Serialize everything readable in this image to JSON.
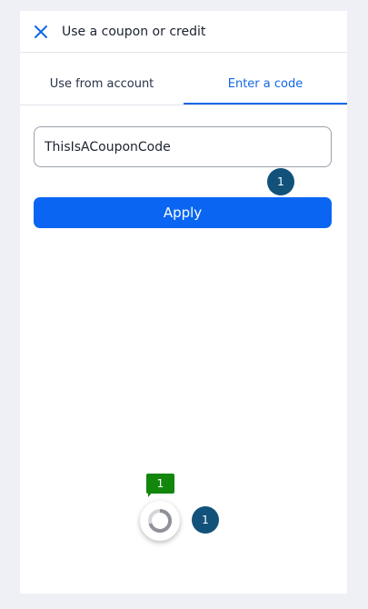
{
  "header": {
    "title": "Use a coupon or credit",
    "close_icon": "close-icon"
  },
  "tabs": [
    {
      "label": "Use from account",
      "active": false
    },
    {
      "label": "Enter a code",
      "active": true
    }
  ],
  "coupon": {
    "value": "ThisIsACouponCode"
  },
  "apply": {
    "label": "Apply"
  },
  "markers": {
    "apply_badge": "1",
    "spinner_badge": "1",
    "spinner_tag": "1"
  },
  "colors": {
    "accent": "#0a66f2",
    "tab_active": "#1268e6",
    "badge": "#12527a",
    "tag": "#12870c",
    "background": "#eef0f6"
  }
}
